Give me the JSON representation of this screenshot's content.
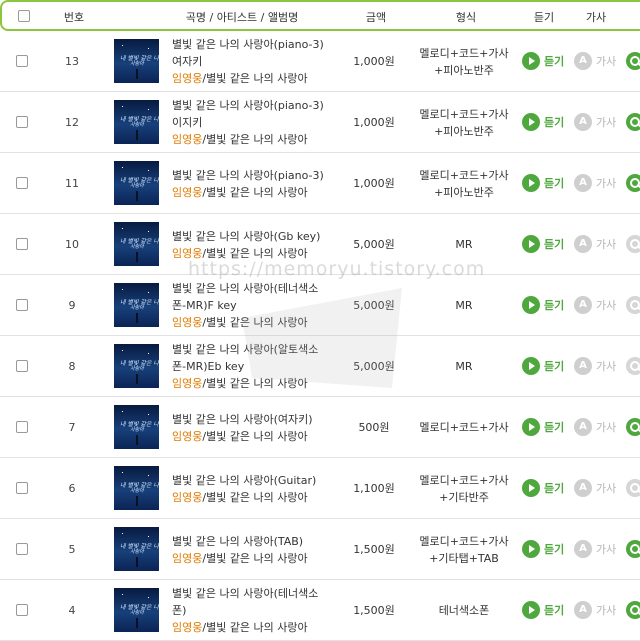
{
  "header": {
    "number_label": "번호",
    "title_label": "곡명 / 아티스트 / 앨범명",
    "price_label": "금액",
    "format_label": "형식",
    "listen_label": "듣기",
    "lyrics_label": "가사"
  },
  "action_labels": {
    "listen": "듣기",
    "lyric_icon": "A",
    "lyric": "가사"
  },
  "thumb_text": {
    "line1": "내 별빛 같은 나의",
    "line2": "사랑아"
  },
  "watermark": "https://memoryu.tistory.com",
  "colors": {
    "accent_green": "#4fa83d",
    "header_border": "#8cc63f",
    "artist_orange": "#e07b00",
    "disabled_gray": "#cfcfcf"
  },
  "rows": [
    {
      "num": "13",
      "title1": "별빛 같은 나의 사랑아(piano-3)",
      "title2": "여자키",
      "artist": "임영웅",
      "album": "/별빛 같은 나의 사랑아",
      "price": "1,000원",
      "format1": "멜로디+코드+가사",
      "format2": "+피아노반주",
      "search_enabled": true
    },
    {
      "num": "12",
      "title1": "별빛 같은 나의 사랑아(piano-3)",
      "title2": "이지키",
      "artist": "임영웅",
      "album": "/별빛 같은 나의 사랑아",
      "price": "1,000원",
      "format1": "멜로디+코드+가사",
      "format2": "+피아노반주",
      "search_enabled": true
    },
    {
      "num": "11",
      "title1": "별빛 같은 나의 사랑아(piano-3)",
      "title2": "",
      "artist": "임영웅",
      "album": "/별빛 같은 나의 사랑아",
      "price": "1,000원",
      "format1": "멜로디+코드+가사",
      "format2": "+피아노반주",
      "search_enabled": true
    },
    {
      "num": "10",
      "title1": "별빛 같은 나의 사랑아(Gb key)",
      "title2": "",
      "artist": "임영웅",
      "album": "/별빛 같은 나의 사랑아",
      "price": "5,000원",
      "format1": "MR",
      "format2": "",
      "search_enabled": false
    },
    {
      "num": "9",
      "title1": "별빛 같은 나의 사랑아(테너색소",
      "title2": "폰-MR)F key",
      "artist": "임영웅",
      "album": "/별빛 같은 나의 사랑아",
      "price": "5,000원",
      "format1": "MR",
      "format2": "",
      "search_enabled": false
    },
    {
      "num": "8",
      "title1": "별빛 같은 나의 사랑아(알토색소",
      "title2": "폰-MR)Eb key",
      "artist": "임영웅",
      "album": "/별빛 같은 나의 사랑아",
      "price": "5,000원",
      "format1": "MR",
      "format2": "",
      "search_enabled": false
    },
    {
      "num": "7",
      "title1": "별빛 같은 나의 사랑아(여자키)",
      "title2": "",
      "artist": "임영웅",
      "album": "/별빛 같은 나의 사랑아",
      "price": "500원",
      "format1": "멜로디+코드+가사",
      "format2": "",
      "search_enabled": true
    },
    {
      "num": "6",
      "title1": "별빛 같은 나의 사랑아(Guitar)",
      "title2": "",
      "artist": "임영웅",
      "album": "/별빛 같은 나의 사랑아",
      "price": "1,100원",
      "format1": "멜로디+코드+가사",
      "format2": "+기타반주",
      "search_enabled": false
    },
    {
      "num": "5",
      "title1": "별빛 같은 나의 사랑아(TAB)",
      "title2": "",
      "artist": "임영웅",
      "album": "/별빛 같은 나의 사랑아",
      "price": "1,500원",
      "format1": "멜로디+코드+가사",
      "format2": "+기타탭+TAB",
      "search_enabled": true
    },
    {
      "num": "4",
      "title1": "별빛 같은 나의 사랑아(테너색소",
      "title2": "폰)",
      "artist": "임영웅",
      "album": "/별빛 같은 나의 사랑아",
      "price": "1,500원",
      "format1": "테너색소폰",
      "format2": "",
      "search_enabled": true
    }
  ]
}
